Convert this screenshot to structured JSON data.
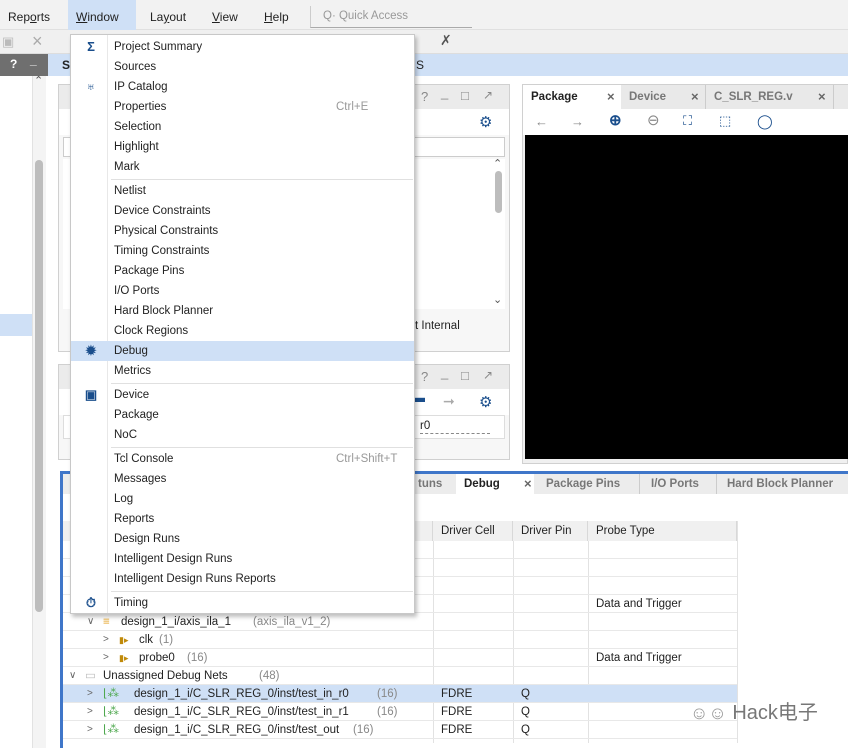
{
  "menubar": {
    "items": [
      {
        "label": "Reports",
        "mnemonic_index": 3
      },
      {
        "label": "Window",
        "mnemonic_index": 0,
        "active": true
      },
      {
        "label": "Layout",
        "mnemonic_index": 2
      },
      {
        "label": "View",
        "mnemonic_index": 0
      },
      {
        "label": "Help",
        "mnemonic_index": 0
      }
    ],
    "quick_access_placeholder": "Q· Quick Access"
  },
  "left_panel": {
    "help_label": "?",
    "minimize_label": "_"
  },
  "section_header": {
    "left_char": "S",
    "right_char": "S"
  },
  "window_menu": {
    "groups": [
      [
        {
          "label": "Project Summary",
          "icon": "sigma-icon",
          "glyph": "Σ"
        },
        {
          "label": "Sources"
        },
        {
          "label": "IP Catalog",
          "icon": "ip-catalog-icon",
          "glyph": "♅"
        },
        {
          "label": "Properties",
          "shortcut": "Ctrl+E"
        },
        {
          "label": "Selection"
        },
        {
          "label": "Highlight"
        },
        {
          "label": "Mark"
        }
      ],
      [
        {
          "label": "Netlist"
        },
        {
          "label": "Device Constraints"
        },
        {
          "label": "Physical Constraints"
        },
        {
          "label": "Timing Constraints"
        },
        {
          "label": "Package Pins"
        },
        {
          "label": "I/O Ports"
        },
        {
          "label": "Hard Block Planner"
        },
        {
          "label": "Clock Regions"
        },
        {
          "label": "Debug",
          "icon": "bug-icon",
          "glyph": "✹",
          "highlighted": true
        },
        {
          "label": "Metrics"
        }
      ],
      [
        {
          "label": "Device",
          "icon": "chip-icon",
          "glyph": "▣"
        },
        {
          "label": "Package"
        },
        {
          "label": "NoC"
        }
      ],
      [
        {
          "label": "Tcl Console",
          "shortcut": "Ctrl+Shift+T"
        },
        {
          "label": "Messages"
        },
        {
          "label": "Log"
        },
        {
          "label": "Reports"
        },
        {
          "label": "Design Runs"
        },
        {
          "label": "Intelligent Design Runs"
        },
        {
          "label": "Intelligent Design Runs Reports"
        }
      ],
      [
        {
          "label": "Timing",
          "icon": "timer-icon",
          "glyph": "⏱"
        }
      ]
    ]
  },
  "mid_panel_top": {
    "partial_text": "t Internal",
    "help": "?",
    "min": "_",
    "max": "□",
    "float": "↗"
  },
  "mid_panel_bottom": {
    "partial_text": "r0",
    "help": "?",
    "min": "_",
    "max": "□",
    "float": "↗"
  },
  "device_view": {
    "tabs": [
      {
        "label": "Package",
        "selected": true
      },
      {
        "label": "Device"
      },
      {
        "label": "C_SLR_REG.v"
      }
    ],
    "close_glyph": "×"
  },
  "bottom_tabs": {
    "items": [
      {
        "label": "Runs",
        "partial": "tuns"
      },
      {
        "label": "Debug",
        "selected": true
      },
      {
        "label": "Package Pins"
      },
      {
        "label": "I/O Ports"
      },
      {
        "label": "Hard Block Planner"
      }
    ]
  },
  "debug_table": {
    "columns": [
      "Driver Cell",
      "Driver Pin",
      "Probe Type"
    ],
    "rows": [
      {
        "indent": 1,
        "expander": "∨",
        "icon": "ila-icon",
        "name": "design_1_i/axis_ila_1",
        "suffix": "(axis_ila_v1_2)",
        "driver_cell": "",
        "driver_pin": "",
        "probe_type": ""
      },
      {
        "indent": 2,
        "expander": ">",
        "icon": "probe-icon",
        "name": "clk",
        "suffix": "(1)",
        "driver_cell": "",
        "driver_pin": "",
        "probe_type": ""
      },
      {
        "indent": 2,
        "expander": ">",
        "icon": "probe-icon",
        "name": "probe0",
        "suffix": "(16)",
        "driver_cell": "",
        "driver_pin": "",
        "probe_type": "Data and Trigger"
      },
      {
        "indent": 0,
        "expander": "∨",
        "icon": "folder-icon",
        "name": "Unassigned Debug Nets",
        "suffix": "(48)",
        "driver_cell": "",
        "driver_pin": "",
        "probe_type": ""
      },
      {
        "indent": 1,
        "expander": ">",
        "icon": "net-icon",
        "name": "design_1_i/C_SLR_REG_0/inst/test_in_r0",
        "suffix": "(16)",
        "driver_cell": "FDRE",
        "driver_pin": "Q",
        "probe_type": "",
        "selected": true
      },
      {
        "indent": 1,
        "expander": ">",
        "icon": "net-icon",
        "name": "design_1_i/C_SLR_REG_0/inst/test_in_r1",
        "suffix": "(16)",
        "driver_cell": "FDRE",
        "driver_pin": "Q",
        "probe_type": ""
      },
      {
        "indent": 1,
        "expander": ">",
        "icon": "net-icon",
        "name": "design_1_i/C_SLR_REG_0/inst/test_out",
        "suffix": "(16)",
        "driver_cell": "FDRE",
        "driver_pin": "Q",
        "probe_type": ""
      }
    ],
    "hidden_row_probe_type": "Data and Trigger"
  },
  "watermark": {
    "text": "Hack电子"
  }
}
